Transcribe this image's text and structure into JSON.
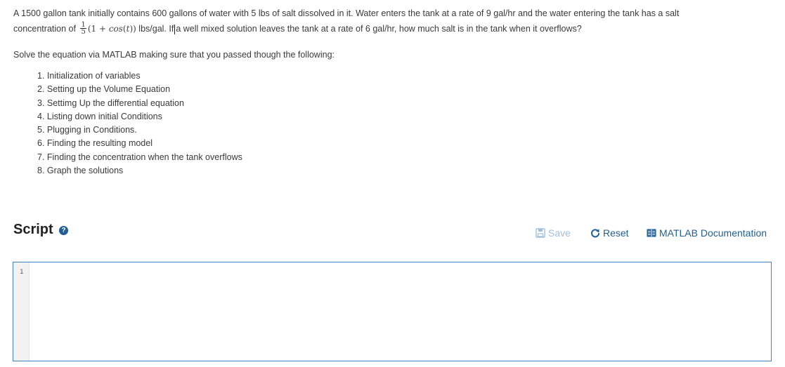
{
  "problem": {
    "line1": "A 1500 gallon tank initially contains 600 gallons of water with 5 lbs of salt dissolved in it. Water enters the tank at a rate of 9 gal/hr and the water entering the tank has a salt",
    "line2_prefix": "concentration of",
    "fraction_numerator": "1",
    "fraction_denominator": "5",
    "expression_open": "(1 + ",
    "expression_func": "cos",
    "expression_arg": "t",
    "expression_close": "))",
    "line2_mid_a": "lbs/gal. If",
    "line2_mid_b": "a well mixed solution leaves the tank at a rate of 6 gal/hr, how much salt is in the tank when it overflows?"
  },
  "instructions": "Solve the equation via MATLAB making sure that you passed though the following:",
  "steps": [
    "1. Initialization of variables",
    "2. Setting up the Volume Equation",
    "3. Settimg Up the differential equation",
    "4. Listing down initial Conditions",
    "5. Plugging in Conditions.",
    "6. Finding the resulting model",
    "7. Finding the concentration when the tank overflows",
    "8. Graph the solutions"
  ],
  "script": {
    "title": "Script",
    "help_icon": "question-circle-icon",
    "save_label": "Save",
    "save_icon": "floppy-disk-icon",
    "reset_label": "Reset",
    "reset_icon": "refresh-icon",
    "doc_label": "MATLAB Documentation",
    "doc_icon": "book-icon"
  },
  "editor": {
    "line_numbers": [
      "1"
    ],
    "content": ""
  },
  "colors": {
    "accent": "#1f5e96",
    "save_disabled": "#9fbfdc",
    "editor_border": "#3d86c6"
  }
}
